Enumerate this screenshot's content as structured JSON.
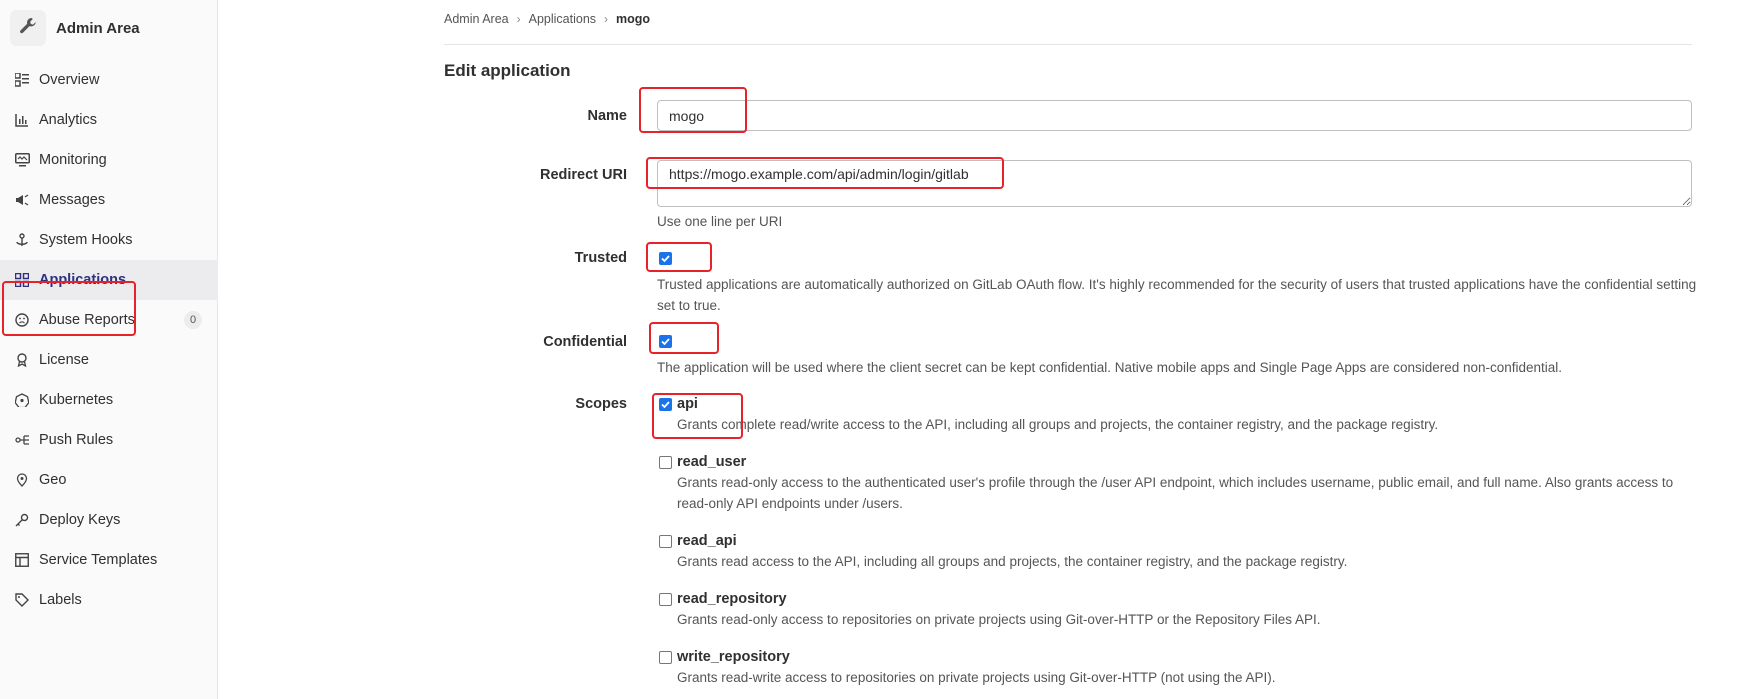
{
  "sidebar": {
    "title": "Admin Area",
    "items": [
      {
        "label": "Overview",
        "icon": "overview-icon"
      },
      {
        "label": "Analytics",
        "icon": "analytics-icon"
      },
      {
        "label": "Monitoring",
        "icon": "monitoring-icon"
      },
      {
        "label": "Messages",
        "icon": "messages-icon"
      },
      {
        "label": "System Hooks",
        "icon": "hooks-icon"
      },
      {
        "label": "Applications",
        "icon": "applications-icon",
        "active": true
      },
      {
        "label": "Abuse Reports",
        "icon": "abuse-icon",
        "count": "0"
      },
      {
        "label": "License",
        "icon": "license-icon"
      },
      {
        "label": "Kubernetes",
        "icon": "kubernetes-icon"
      },
      {
        "label": "Push Rules",
        "icon": "push-rules-icon"
      },
      {
        "label": "Geo",
        "icon": "geo-icon"
      },
      {
        "label": "Deploy Keys",
        "icon": "key-icon"
      },
      {
        "label": "Service Templates",
        "icon": "template-icon"
      },
      {
        "label": "Labels",
        "icon": "label-icon"
      }
    ]
  },
  "breadcrumb": {
    "items": [
      "Admin Area",
      "Applications",
      "mogo"
    ]
  },
  "page": {
    "title": "Edit application"
  },
  "form": {
    "name_label": "Name",
    "name_value": "mogo",
    "redirect_label": "Redirect URI",
    "redirect_value": "https://mogo.example.com/api/admin/login/gitlab",
    "redirect_help": "Use one line per URI",
    "trusted_label": "Trusted",
    "trusted_checked": true,
    "trusted_help": "Trusted applications are automatically authorized on GitLab OAuth flow. It's highly recommended for the security of users that trusted applications have the confidential setting set to true.",
    "confidential_label": "Confidential",
    "confidential_checked": true,
    "confidential_help": "The application will be used where the client secret can be kept confidential. Native mobile apps and Single Page Apps are considered non-confidential.",
    "scopes_label": "Scopes",
    "scopes": [
      {
        "name": "api",
        "checked": true,
        "desc": "Grants complete read/write access to the API, including all groups and projects, the container registry, and the package registry."
      },
      {
        "name": "read_user",
        "checked": false,
        "desc": "Grants read-only access to the authenticated user's profile through the /user API endpoint, which includes username, public email, and full name. Also grants access to read-only API endpoints under /users."
      },
      {
        "name": "read_api",
        "checked": false,
        "desc": "Grants read access to the API, including all groups and projects, the container registry, and the package registry."
      },
      {
        "name": "read_repository",
        "checked": false,
        "desc": "Grants read-only access to repositories on private projects using Git-over-HTTP or the Repository Files API."
      },
      {
        "name": "write_repository",
        "checked": false,
        "desc": "Grants read-write access to repositories on private projects using Git-over-HTTP (not using the API)."
      }
    ]
  },
  "colors": {
    "highlight": "#e8222b",
    "checkbox": "#1a73e8",
    "active_bg": "#ececef"
  }
}
